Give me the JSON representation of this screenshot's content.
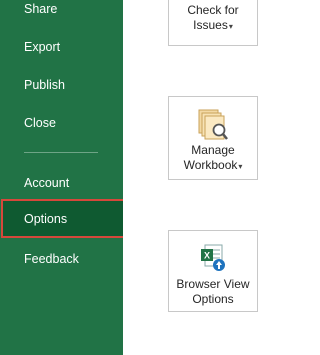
{
  "sidebar": {
    "items": [
      {
        "label": "Share"
      },
      {
        "label": "Export"
      },
      {
        "label": "Publish"
      },
      {
        "label": "Close"
      },
      {
        "label": "Account"
      },
      {
        "label": "Options",
        "selected": true
      },
      {
        "label": "Feedback"
      }
    ]
  },
  "tiles": {
    "check_issues": {
      "line1": "Check for",
      "line2": "Issues",
      "caret": "▾",
      "icon": "check-issues-icon"
    },
    "manage_workbook": {
      "line1": "Manage",
      "line2": "Workbook",
      "caret": "▾",
      "icon": "manage-workbook-icon"
    },
    "browser_view": {
      "line1": "Browser View",
      "line2": "Options",
      "icon": "browser-view-icon"
    }
  },
  "colors": {
    "sidebar_bg": "#217346",
    "selected_bg": "#0f5a31",
    "selected_outline": "#d6483b"
  }
}
